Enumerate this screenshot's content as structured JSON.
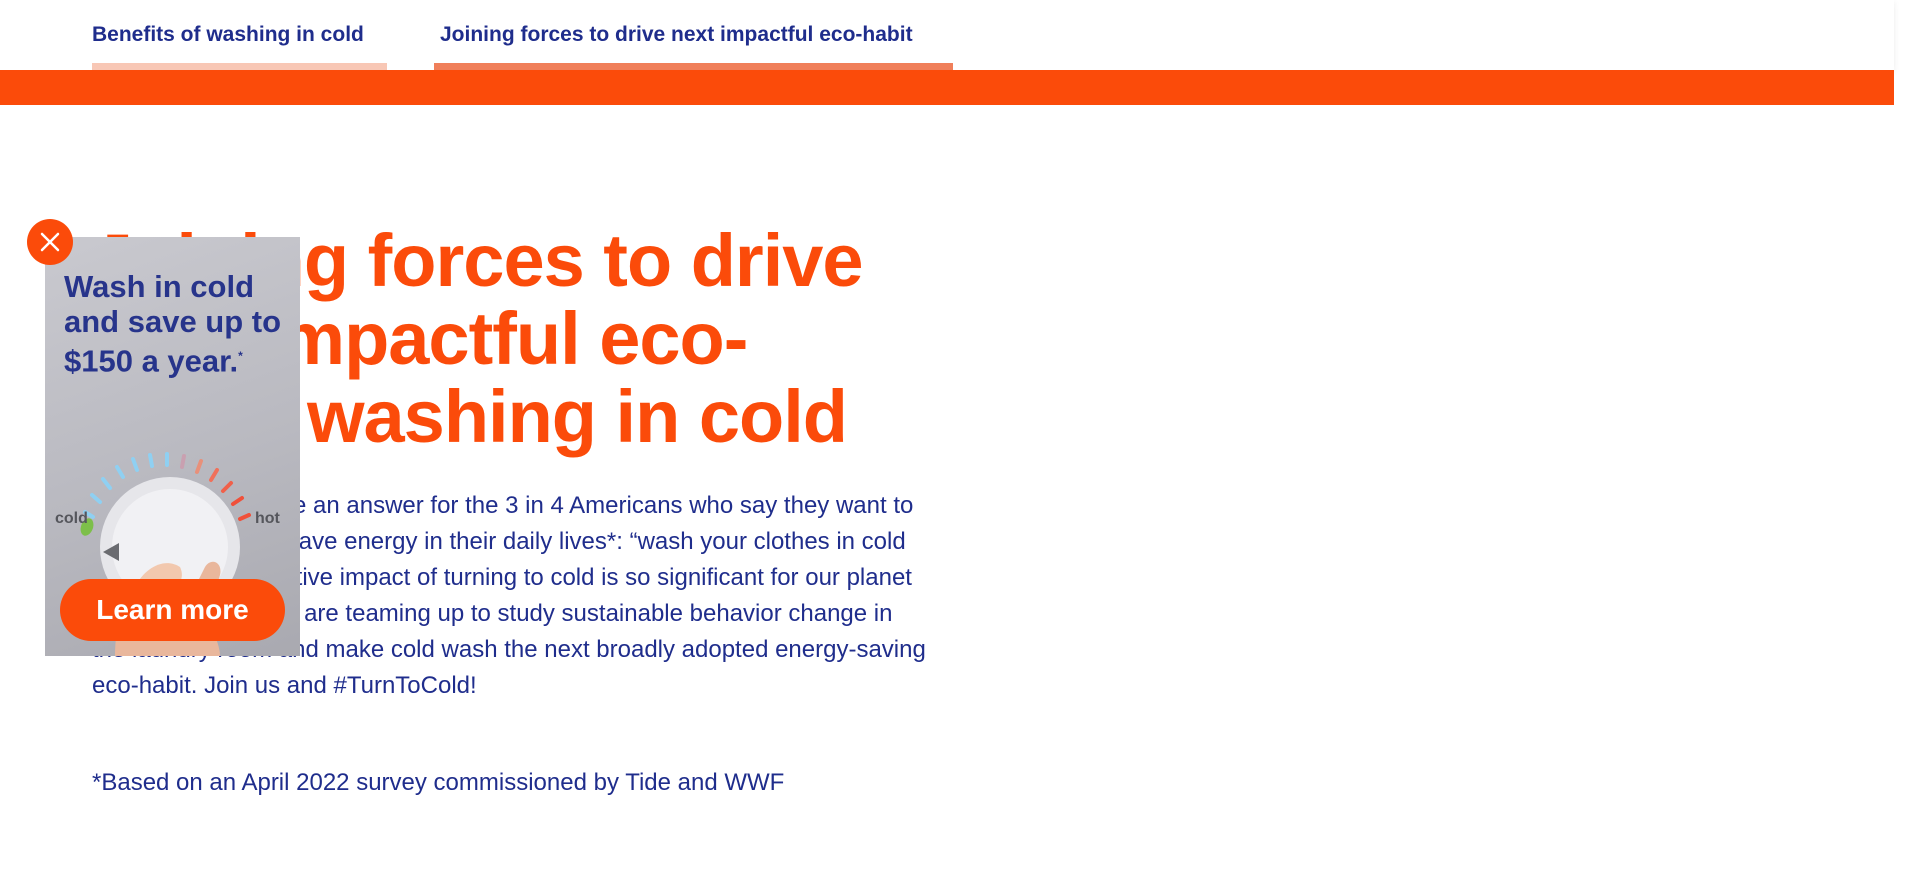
{
  "nav": {
    "tabs": [
      {
        "label": "Benefits of washing in cold"
      },
      {
        "label": "Joining forces to drive next impactful eco-habit"
      }
    ]
  },
  "main": {
    "headline": "Joining forces to drive next impactful eco-habit: washing in cold",
    "body": "We believe we have an answer for the 3 in 4 Americans who say they want to find more ways to save energy in their daily lives*: “wash your clothes in cold water.” The cumulative impact of turning to cold is so significant for our planet that Tide and WWF are teaming up to study sustainable behavior change in the laundry room and make cold wash the next broadly adopted energy-saving eco-habit. Join us and #TurnToCold!",
    "footnote": "*Based on an April 2022 survey commissioned by Tide and WWF"
  },
  "popup": {
    "title": "Wash in cold and save up to $150 a year.",
    "title_mark": "*",
    "cold_label": "cold",
    "hot_label": "hot",
    "cta": "Learn more",
    "close_icon": "close-icon"
  },
  "colors": {
    "accent": "#fb4b0a",
    "text": "#1f2d8c",
    "tab_bar_inactive": "#f8c7b5",
    "tab_bar_active": "#f07f5a"
  }
}
